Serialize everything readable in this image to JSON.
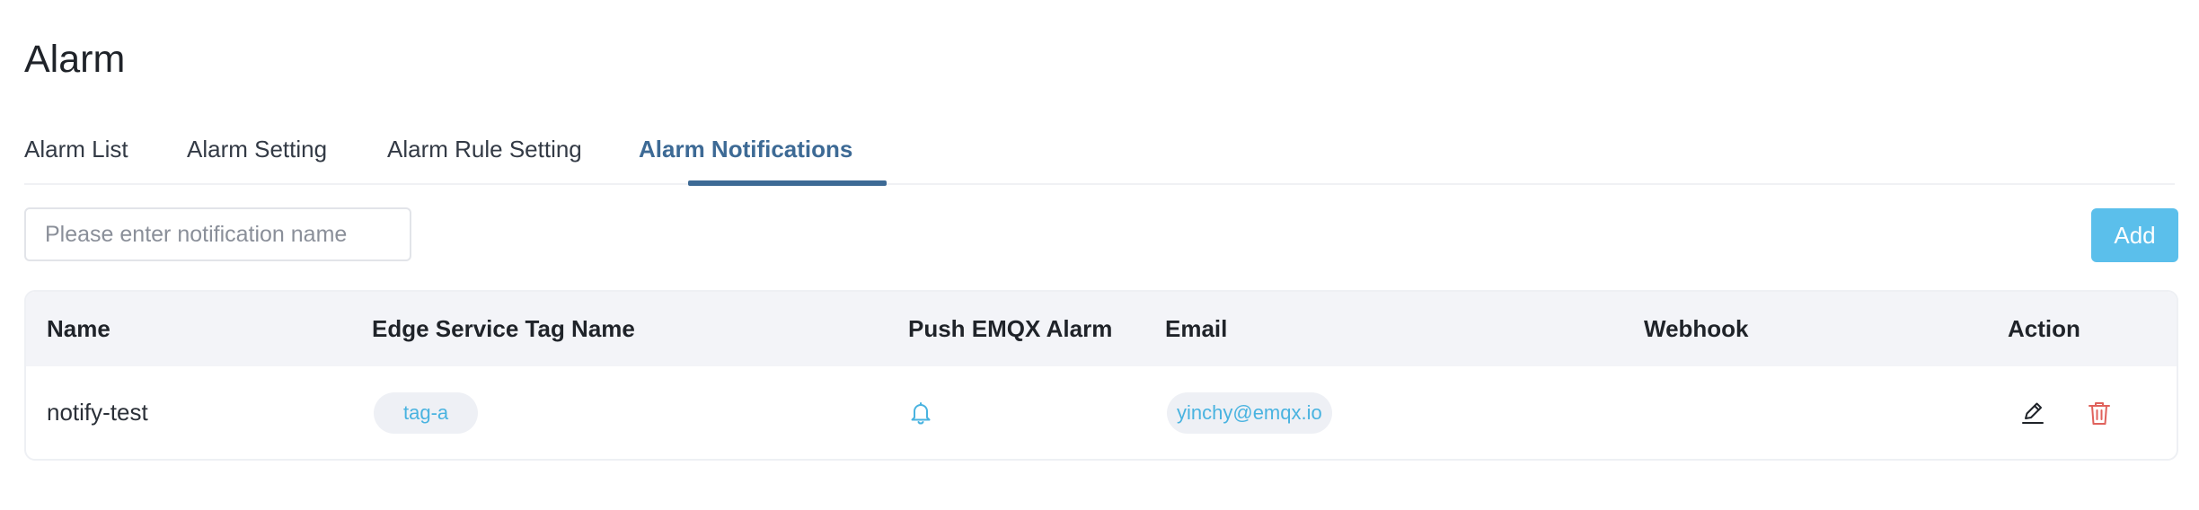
{
  "page": {
    "title": "Alarm"
  },
  "tabs": [
    {
      "label": "Alarm List",
      "active": false
    },
    {
      "label": "Alarm Setting",
      "active": false
    },
    {
      "label": "Alarm Rule Setting",
      "active": false
    },
    {
      "label": "Alarm Notifications",
      "active": true
    }
  ],
  "search": {
    "placeholder": "Please enter notification name",
    "value": ""
  },
  "toolbar": {
    "add_label": "Add"
  },
  "table": {
    "columns": [
      "Name",
      "Edge Service Tag Name",
      "Push EMQX Alarm",
      "Email",
      "Webhook",
      "Action"
    ],
    "rows": [
      {
        "name": "notify-test",
        "tags": [
          "tag-a"
        ],
        "push_emqx_alarm_icon": "bell-icon",
        "email": "yinchy@emqx.io",
        "webhook": "",
        "actions": [
          "edit-icon",
          "delete-icon"
        ]
      }
    ]
  },
  "colors": {
    "accent": "#3d6a95",
    "primary_button": "#5bbfeb",
    "pill_text": "#49b3e0",
    "delete": "#e0625c"
  }
}
